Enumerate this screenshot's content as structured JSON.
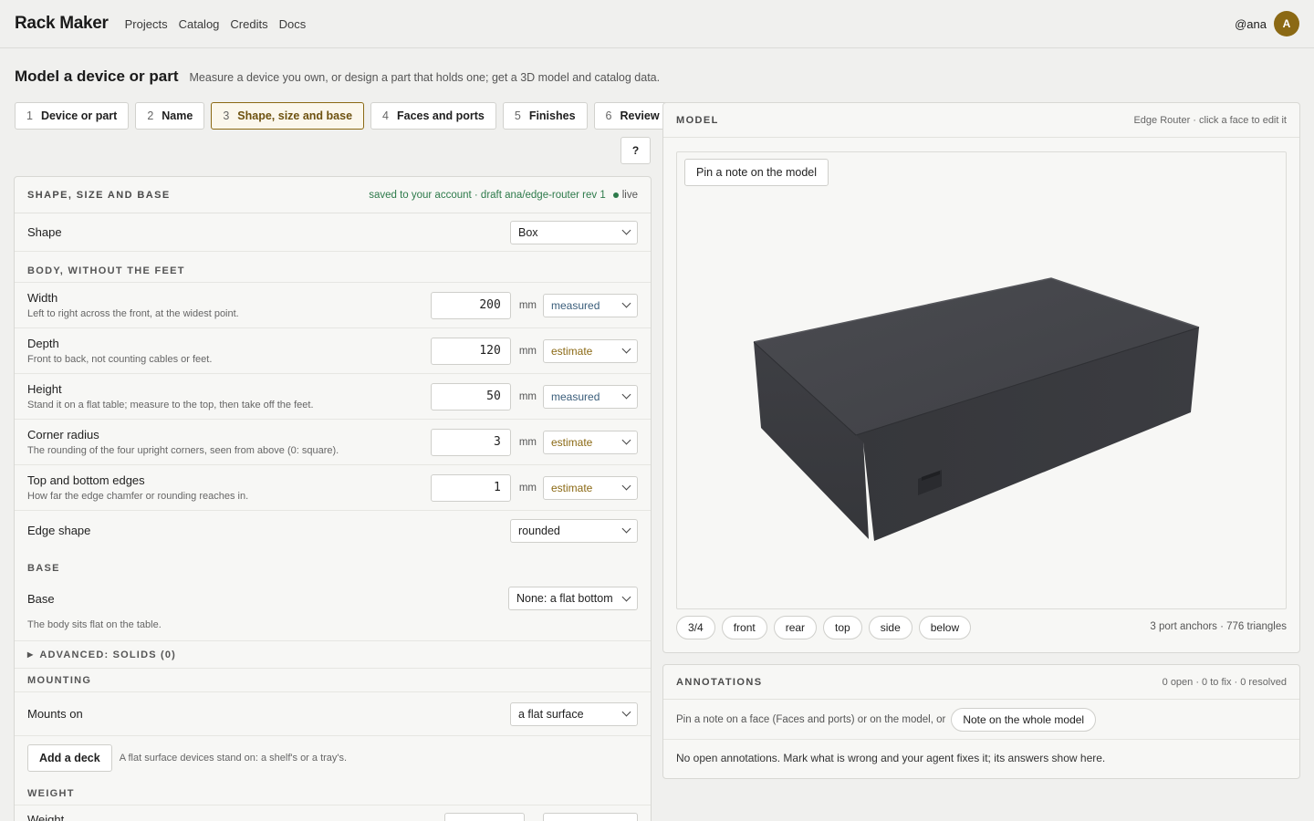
{
  "app": {
    "name": "Rack Maker",
    "nav": [
      "Projects",
      "Catalog",
      "Credits",
      "Docs"
    ],
    "user_handle": "@ana",
    "avatar_initial": "A",
    "accent_color": "#8b6914"
  },
  "page": {
    "title": "Model a device or part",
    "subtitle": "Measure a device you own, or design a part that holds one; get a 3D model and catalog data."
  },
  "steps": [
    {
      "num": "1",
      "label": "Device or part",
      "active": false
    },
    {
      "num": "2",
      "label": "Name",
      "active": false
    },
    {
      "num": "3",
      "label": "Shape, size and base",
      "active": true
    },
    {
      "num": "4",
      "label": "Faces and ports",
      "active": false
    },
    {
      "num": "5",
      "label": "Finishes",
      "active": false
    },
    {
      "num": "6",
      "label": "Review",
      "active": false
    }
  ],
  "help_label": "?",
  "form": {
    "title": "SHAPE, SIZE AND BASE",
    "saved_status": "saved to your account · draft ana/edge-router rev 1",
    "live_label": "live",
    "shape": {
      "label": "Shape",
      "value": "Box"
    },
    "body_heading": "BODY, WITHOUT THE FEET",
    "dimensions": [
      {
        "label": "Width",
        "hint": "Left to right across the front, at the widest point.",
        "value": "200",
        "unit": "mm",
        "confidence": "measured"
      },
      {
        "label": "Depth",
        "hint": "Front to back, not counting cables or feet.",
        "value": "120",
        "unit": "mm",
        "confidence": "estimate"
      },
      {
        "label": "Height",
        "hint": "Stand it on a flat table; measure to the top, then take off the feet.",
        "value": "50",
        "unit": "mm",
        "confidence": "measured"
      },
      {
        "label": "Corner radius",
        "hint": "The rounding of the four upright corners, seen from above (0: square).",
        "value": "3",
        "unit": "mm",
        "confidence": "estimate"
      },
      {
        "label": "Top and bottom edges",
        "hint": "How far the edge chamfer or rounding reaches in.",
        "value": "1",
        "unit": "mm",
        "confidence": "estimate"
      }
    ],
    "edge_shape": {
      "label": "Edge shape",
      "value": "rounded"
    },
    "base_heading": "BASE",
    "base": {
      "label": "Base",
      "value": "None: a flat bottom",
      "note": "The body sits flat on the table."
    },
    "advanced_label": "ADVANCED: SOLIDS (0)",
    "mounting_heading": "MOUNTING",
    "mounts_on": {
      "label": "Mounts on",
      "value": "a flat surface"
    },
    "add_deck": {
      "label": "Add a deck",
      "note": "A flat surface devices stand on: a shelf's or a tray's."
    },
    "weight_heading": "WEIGHT",
    "weight_label": "Weight"
  },
  "model": {
    "title": "MODEL",
    "meta": "Edge Router · click a face to edit it",
    "pin_label": "Pin a note on the model",
    "views": [
      "3/4",
      "front",
      "rear",
      "top",
      "side",
      "below"
    ],
    "stats": "3 port anchors · 776 triangles",
    "body_color": "#3c3d42"
  },
  "annotations": {
    "title": "ANNOTATIONS",
    "counts": "0 open · 0 to fix · 0 resolved",
    "prompt": "Pin a note on a face (Faces and ports) or on the model, or",
    "whole_model_button": "Note on the whole model",
    "empty": "No open annotations. Mark what is wrong and your agent fixes it; its answers show here."
  }
}
